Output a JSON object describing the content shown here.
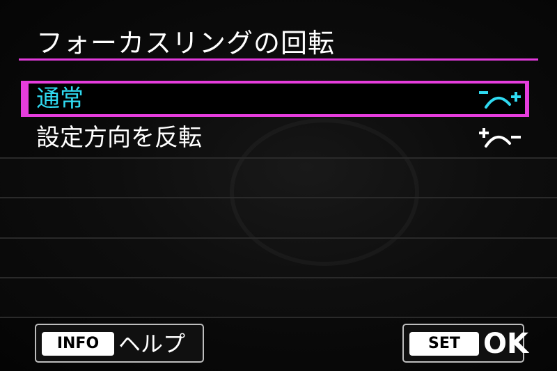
{
  "title": "フォーカスリングの回転",
  "menu": {
    "items": [
      {
        "label": "通常",
        "selected": true,
        "icon": "minus-arc-plus-icon"
      },
      {
        "label": "設定方向を反転",
        "selected": false,
        "icon": "plus-arc-minus-icon"
      }
    ]
  },
  "footer": {
    "help": {
      "key": "INFO",
      "label": "ヘルプ"
    },
    "ok": {
      "key": "SET",
      "label": "OK"
    }
  },
  "colors": {
    "accent": "#e63ddd",
    "selected_text": "#2fd9f0",
    "text": "#ffffff",
    "background": "#050505"
  }
}
